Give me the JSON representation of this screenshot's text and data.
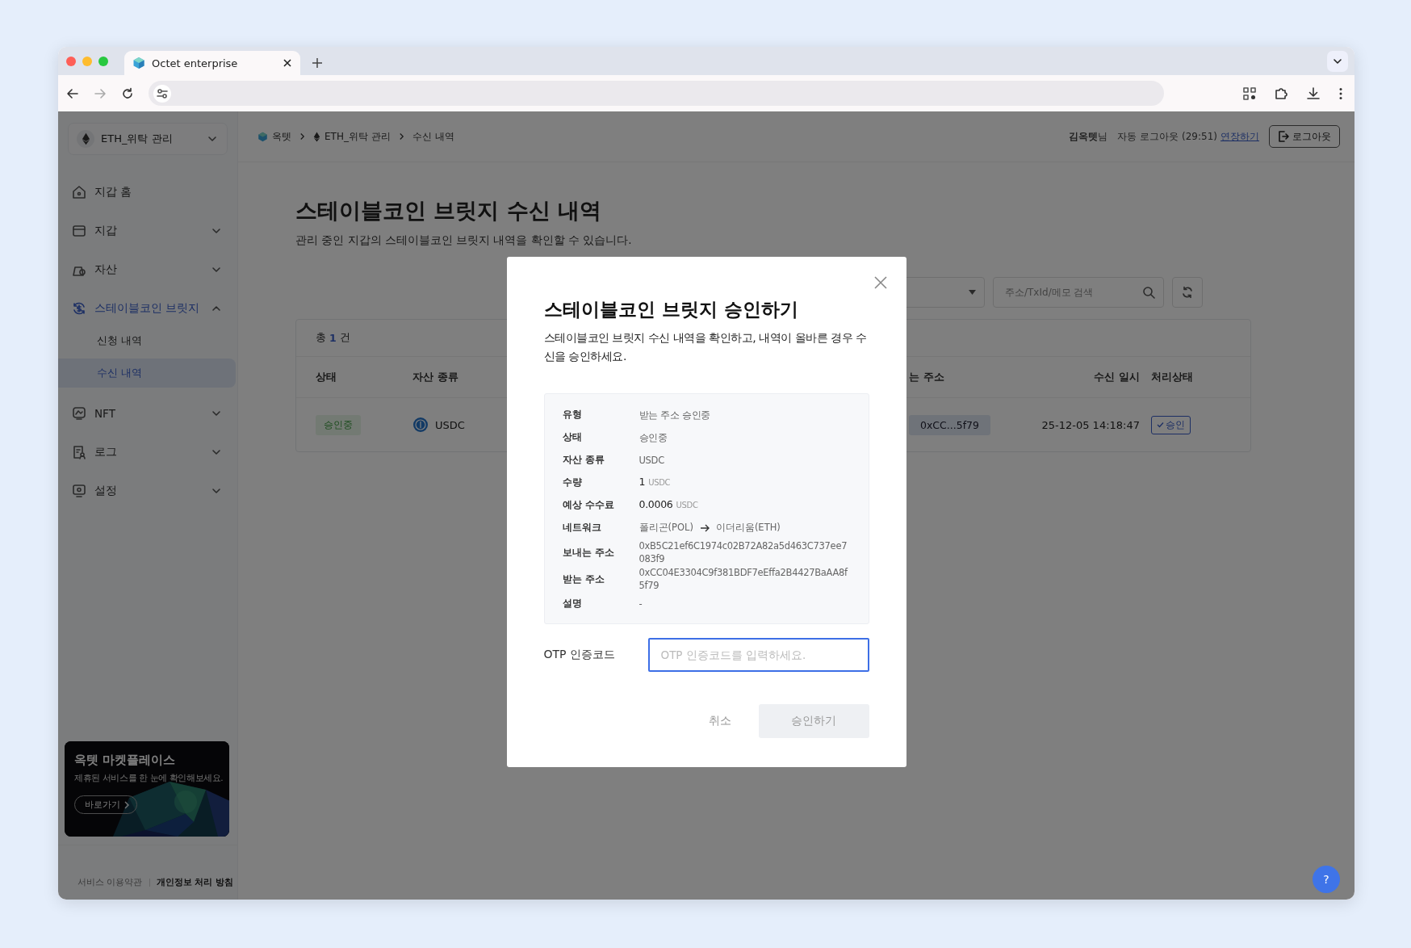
{
  "browser": {
    "tab_title": "Octet enterprise"
  },
  "sidebar": {
    "wallet_selector": "ETH_위탁 관리",
    "items": [
      {
        "label": "지갑 홈",
        "expandable": false,
        "expanded": false
      },
      {
        "label": "지갑",
        "expandable": true,
        "expanded": false
      },
      {
        "label": "자산",
        "expandable": true,
        "expanded": false
      },
      {
        "label": "스테이블코인 브릿지",
        "expandable": true,
        "expanded": true,
        "children": [
          {
            "label": "신청 내역",
            "selected": false
          },
          {
            "label": "수신 내역",
            "selected": true
          }
        ]
      },
      {
        "label": "NFT",
        "expandable": true,
        "expanded": false
      },
      {
        "label": "로그",
        "expandable": true,
        "expanded": false
      },
      {
        "label": "설정",
        "expandable": true,
        "expanded": false
      }
    ],
    "promo": {
      "title": "옥텟 마켓플레이스",
      "text": "제휴된 서비스를 한 눈에 확인해보세요.",
      "button": "바로가기"
    },
    "footer_links": [
      {
        "label": "서비스 이용약관",
        "bold": false
      },
      {
        "label": "개인정보 처리 방침",
        "bold": true
      }
    ]
  },
  "header": {
    "breadcrumbs": [
      "옥텟",
      "ETH_위탁 관리",
      "수신 내역"
    ],
    "user": "**김옥텟**님",
    "auto_logout": "자동 로그아웃 (29:51)",
    "extend_link": "연장하기",
    "logout_button": "로그아웃"
  },
  "page": {
    "title": "스테이블코인 브릿지 수신 내역",
    "subtitle": "관리 중인 지갑의 스테이블코인 브릿지 내역을 확인할 수 있습니다.",
    "search": {
      "placeholder": "주소/TxId/메모 검색"
    },
    "table": {
      "total_prefix": "총",
      "total_count": "1",
      "total_suffix": "건",
      "columns": [
        "상태",
        "자산 종류",
        "는 주소",
        "수신 일시",
        "처리상태"
      ],
      "rows": [
        {
          "status": "승인중",
          "asset": "USDC",
          "address": "0xCC...5f79",
          "received_at": "25-12-05 14:18:47",
          "action": "승인"
        }
      ]
    }
  },
  "modal": {
    "title": "스테이블코인 브릿지 승인하기",
    "description": "스테이블코인 브릿지 수신 내역을 확인하고, 내역이 올바른 경우 수신을 승인하세요.",
    "details": [
      {
        "kind": "text",
        "label": "유형",
        "value": "받는 주소 승인중"
      },
      {
        "kind": "text",
        "label": "상태",
        "value": "승인중"
      },
      {
        "kind": "text",
        "label": "자산 종류",
        "value": "USDC"
      },
      {
        "kind": "amount",
        "label": "수량",
        "value": "1",
        "unit": "USDC"
      },
      {
        "kind": "amount",
        "label": "예상 수수료",
        "value": "0.0006",
        "unit": "USDC"
      },
      {
        "kind": "route",
        "label": "네트워크",
        "from": "폴리곤(POL)",
        "to": "이더리움(ETH)"
      },
      {
        "kind": "text",
        "label": "보내는 주소",
        "value": "0xB5C21ef6C1974c02B72A82a5d463C737ee7083f9"
      },
      {
        "kind": "text",
        "label": "받는 주소",
        "value": "0xCC04E3304C9f381BDF7eEffa2B4427BaAA8f5f79"
      },
      {
        "kind": "text",
        "label": "설명",
        "value": "-"
      }
    ],
    "otp_label": "OTP 인증코드",
    "otp_placeholder": "OTP 인증코드를 입력하세요.",
    "cancel": "취소",
    "confirm": "승인하기",
    "confirm_disabled": true
  },
  "help_button": "?"
}
